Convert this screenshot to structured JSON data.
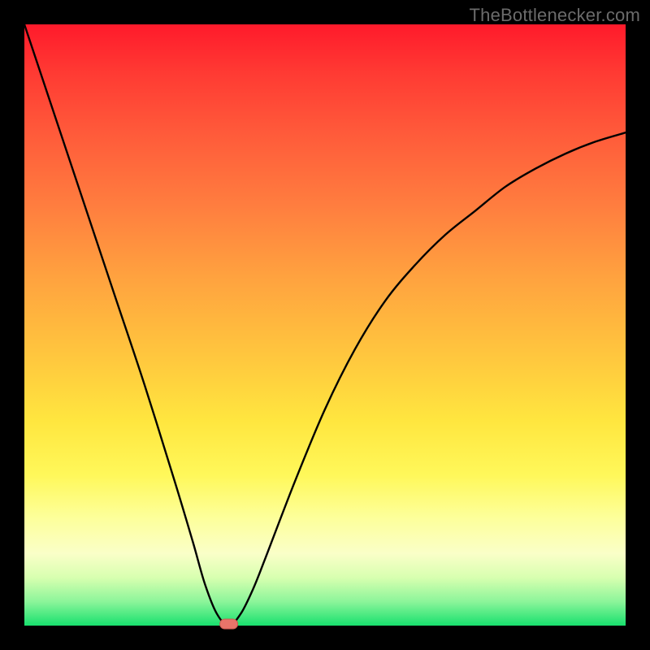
{
  "watermark": {
    "text": "TheBottlenecker.com"
  },
  "chart_data": {
    "type": "line",
    "title": "",
    "xlabel": "",
    "ylabel": "",
    "xlim": [
      0,
      100
    ],
    "ylim": [
      0,
      100
    ],
    "grid": false,
    "legend": false,
    "series": [
      {
        "name": "bottleneck-curve",
        "x": [
          0,
          5,
          10,
          15,
          20,
          25,
          28,
          30,
          32,
          34,
          36,
          38,
          40,
          45,
          50,
          55,
          60,
          65,
          70,
          75,
          80,
          85,
          90,
          95,
          100
        ],
        "values": [
          100,
          85,
          70,
          55,
          40,
          24,
          14,
          7,
          2,
          0,
          2,
          6,
          11,
          24,
          36,
          46,
          54,
          60,
          65,
          69,
          73,
          76,
          78.5,
          80.5,
          82
        ]
      }
    ],
    "marker": {
      "x": 34,
      "y": 0,
      "color": "#e8746a",
      "shape": "pill"
    },
    "background_gradient": {
      "top": "#ff1a2b",
      "mid": "#ffe63f",
      "bottom": "#18e06e"
    }
  }
}
